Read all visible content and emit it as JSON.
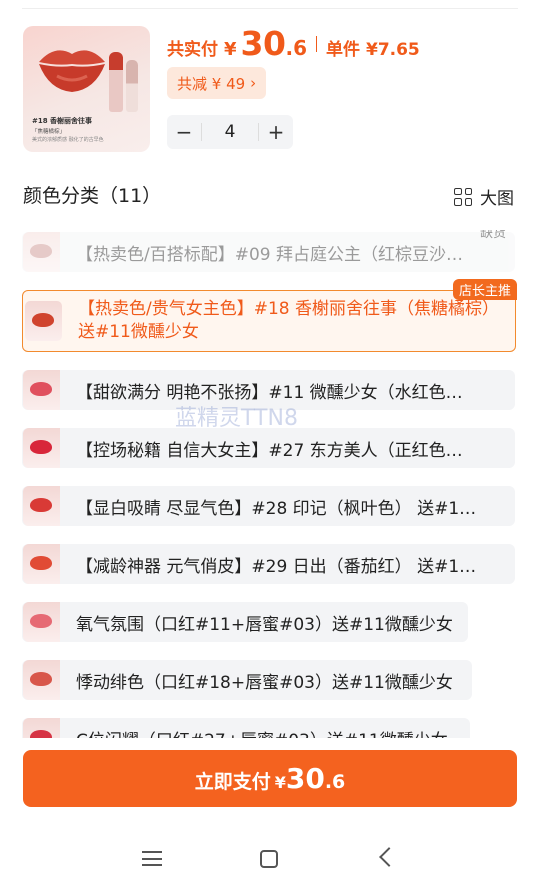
{
  "product": {
    "thumb_title": "#18 香榭丽舍往事",
    "thumb_subtitle": "「焦糖橘棕」",
    "thumb_note": "美式的浓郁质感 融化了的古早色"
  },
  "price": {
    "pay_label": "共实付",
    "yen": "¥",
    "amount_int": "30",
    "amount_dec": ".6",
    "unit_label": "单件",
    "unit_price": "¥7.65"
  },
  "discount": {
    "label": "共减 ¥ 49",
    "chevron": "›"
  },
  "stepper": {
    "minus": "−",
    "quantity": "4",
    "plus": "+"
  },
  "section": {
    "title": "颜色分类（11）",
    "view_label": "大图"
  },
  "options": [
    {
      "label": "【热卖色/百搭标配】#09 拜占庭公主（红棕豆沙…",
      "note": "缺货",
      "color": "#c98c86"
    },
    {
      "label": "【热卖色/贵气女主色】#18 香榭丽舍往事（焦糖橘棕）送#11微醺少女",
      "badge": "店长主推",
      "color": "#d0442e"
    },
    {
      "label": "【甜欲满分 明艳不张扬】#11 微醺少女（水红色…",
      "color": "#e0505e"
    },
    {
      "label": "【控场秘籍 自信大女主】#27 东方美人（正红色…",
      "color": "#d8263a"
    },
    {
      "label": "【显白吸睛 尽显气色】#28 印记（枫叶色） 送#1…",
      "color": "#d93a36"
    },
    {
      "label": "【减龄神器 元气俏皮】#29 日出（番茄红） 送#1…",
      "color": "#e14b35"
    },
    {
      "label": "氧气氛围（口红#11+唇蜜#03）送#11微醺少女",
      "color": "#e66a74"
    },
    {
      "label": "悸动绯色（口红#18+唇蜜#03）送#11微醺少女",
      "color": "#d8564a"
    },
    {
      "label": "C位闪耀（口红#27+唇蜜#03）送#11微醺少女",
      "color": "#d63344"
    }
  ],
  "watermark": "蓝精灵TTN8",
  "pay_button": {
    "label": "立即支付",
    "yen": "¥",
    "amount_int": "30",
    "amount_dec": ".6"
  }
}
